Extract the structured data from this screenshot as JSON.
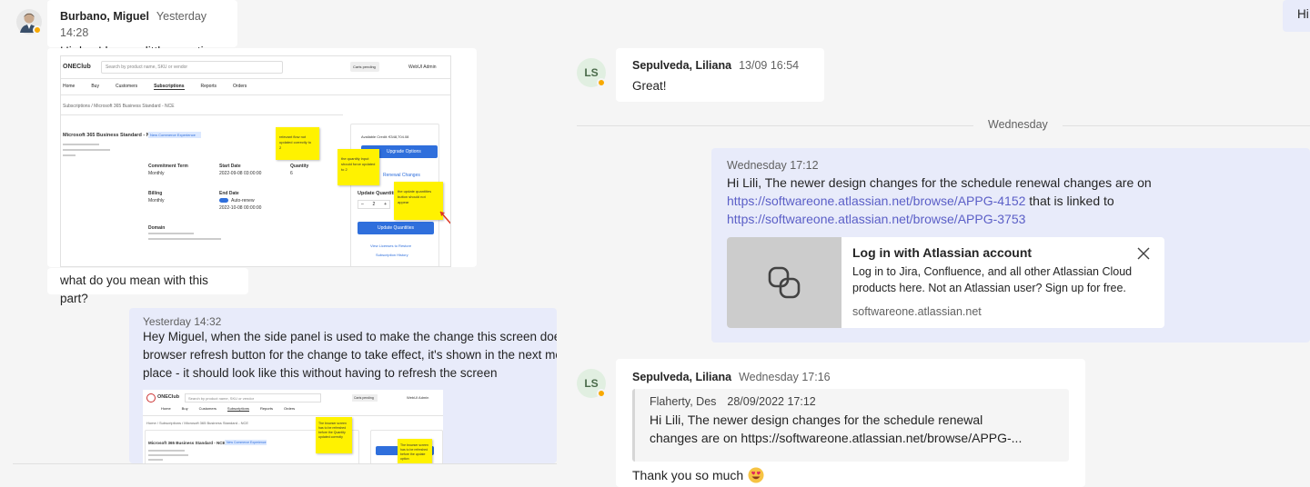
{
  "left": {
    "msg1": {
      "sender": "Burbano, Miguel",
      "time": "Yesterday 14:28",
      "text": "Hi des I have a little question"
    },
    "msg1_screenshot": {
      "brand": "ONEClub",
      "search_placeholder": "Search by product name, SKU or vendor",
      "cart": "Carts pending",
      "user": "WebUI Admin",
      "nav": [
        "Home",
        "Buy",
        "Customers",
        "Subscriptions",
        "Reports",
        "Orders"
      ],
      "breadcrumb": "Subscriptions / Microsoft 365 Business Standard - NCE",
      "product": "Microsoft 365 Business Standard - NCE",
      "tag": "New Commerce Experience",
      "fields": [
        "Commitment Term",
        "Start Date",
        "Quantity",
        "Billing",
        "End Date"
      ],
      "values": [
        "Monthly",
        "2022-09-08 03:00:00",
        "6",
        "Monthly",
        "2022-10-08 00:00:00"
      ],
      "auto_renew": "Auto-renew",
      "domain_label": "Domain",
      "credit": "Available Credit: €348,704.08",
      "upgrade": "Upgrade Options",
      "renewal": "Renewal Changes",
      "update_qty_title": "Update Quantities",
      "update_qty_btn": "Update Quantities",
      "license_link": "View Licenses to Restore",
      "history_link": "Subscription History",
      "note1": "relevant flow not updated correctly to 2",
      "note2": "the quantity input should force updated to 2",
      "note3": "the update quantities button should not appear"
    },
    "msg2": {
      "text": "what do you mean with this part?"
    },
    "msg3": {
      "time": "Yesterday 14:32",
      "lines": [
        "Hey Miguel, when the side panel is used to make the change this screen doesn",
        "browser refresh button for the change to take effect, it's shown in the next mo",
        "place - it should look like this without having to refresh the screen"
      ]
    },
    "msg3_screenshot": {
      "brand": "ONEClub",
      "search_placeholder": "Search by product name, SKU or vendor",
      "cart": "Carts pending",
      "user": "WebUI Admin",
      "nav": [
        "Home",
        "Buy",
        "Customers",
        "Subscriptions",
        "Reports",
        "Orders"
      ],
      "breadcrumb": "Home / Subscriptions / Microsoft 365 Business Standard - NCE",
      "product": "Microsoft 365 Business Standard - NCE",
      "tag": "New Commerce Experience",
      "note1": "The browser screen has to be refreshed before the Quantity updated correctly",
      "note2": "The browser screen has to be refreshed before the update option"
    }
  },
  "right": {
    "top_chip": "Hi",
    "msg1": {
      "initials": "LS",
      "sender": "Sepulveda, Liliana",
      "time": "13/09 16:54",
      "text": "Great!"
    },
    "divider": "Wednesday",
    "msg2": {
      "time": "Wednesday 17:12",
      "text_before": "Hi Lili, The newer design changes for the schedule renewal changes are on",
      "link1": "https://softwareone.atlassian.net/browse/APPG-4152",
      "text_mid": " that is linked to",
      "link2": "https://softwareone.atlassian.net/browse/APPG-3753",
      "preview": {
        "title": "Log in with Atlassian account",
        "desc": "Log in to Jira, Confluence, and all other Atlassian Cloud products here. Not an Atlassian user? Sign up for free.",
        "domain": "softwareone.atlassian.net"
      }
    },
    "msg3": {
      "initials": "LS",
      "sender": "Sepulveda, Liliana",
      "time": "Wednesday 17:16",
      "quote_sender": "Flaherty, Des",
      "quote_time": "28/09/2022 17:12",
      "quote_line1": "Hi Lili, The newer design changes for the schedule renewal",
      "quote_line2": "changes are on https://softwareone.atlassian.net/browse/APPG-...",
      "text": "Thank you so much"
    }
  },
  "colors": {
    "accent": "#5b5fc7",
    "own_bubble": "#e8ebfa",
    "presence_away": "#f8a900",
    "note": "#fff200"
  },
  "icons": [
    "user-avatar",
    "away-presence-icon",
    "link-preview-icon",
    "close-icon",
    "heart-eyes-emoji"
  ]
}
